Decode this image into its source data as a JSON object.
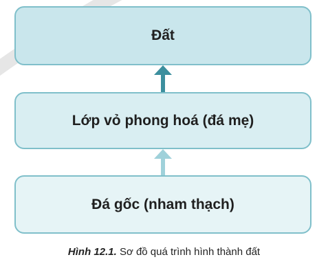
{
  "diagram": {
    "boxes": [
      {
        "label": "Đất"
      },
      {
        "label": "Lớp vỏ phong hoá (đá mẹ)"
      },
      {
        "label": "Đá gốc (nham thạch)"
      }
    ],
    "colors": {
      "box_top_fill": "#c9e6ec",
      "box_mid_fill": "#d9eef2",
      "box_bottom_fill": "#e6f4f6",
      "box_border": "#7fbfca",
      "arrow_dark": "#3c8f9e",
      "arrow_light": "#9fd1da"
    }
  },
  "caption": {
    "figure_label": "Hình 12.1.",
    "text": "Sơ đồ quá trình hình thành đất"
  }
}
